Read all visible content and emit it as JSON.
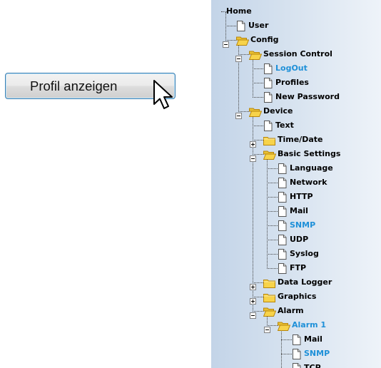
{
  "button": {
    "label": "Profil anzeigen"
  },
  "tree": {
    "items": [
      {
        "label": "Home",
        "level": 0,
        "type": "none",
        "toggle": "none",
        "highlight": false
      },
      {
        "label": "User",
        "level": 1,
        "type": "file",
        "toggle": "none",
        "highlight": false
      },
      {
        "label": "Config",
        "level": 1,
        "type": "folder-open",
        "toggle": "minus",
        "highlight": false
      },
      {
        "label": "Session Control",
        "level": 2,
        "type": "folder-open",
        "toggle": "minus",
        "highlight": false
      },
      {
        "label": "LogOut",
        "level": 3,
        "type": "file",
        "toggle": "none",
        "highlight": true
      },
      {
        "label": "Profiles",
        "level": 3,
        "type": "file",
        "toggle": "none",
        "highlight": false
      },
      {
        "label": "New Password",
        "level": 3,
        "type": "file",
        "toggle": "none",
        "highlight": false
      },
      {
        "label": "Device",
        "level": 2,
        "type": "folder-open",
        "toggle": "minus",
        "highlight": false
      },
      {
        "label": "Text",
        "level": 3,
        "type": "file",
        "toggle": "none",
        "highlight": false
      },
      {
        "label": "Time/Date",
        "level": 3,
        "type": "folder",
        "toggle": "plus",
        "highlight": false
      },
      {
        "label": "Basic Settings",
        "level": 3,
        "type": "folder-open",
        "toggle": "minus",
        "highlight": false
      },
      {
        "label": "Language",
        "level": 4,
        "type": "file",
        "toggle": "none",
        "highlight": false
      },
      {
        "label": "Network",
        "level": 4,
        "type": "file",
        "toggle": "none",
        "highlight": false
      },
      {
        "label": "HTTP",
        "level": 4,
        "type": "file",
        "toggle": "none",
        "highlight": false
      },
      {
        "label": "Mail",
        "level": 4,
        "type": "file",
        "toggle": "none",
        "highlight": false
      },
      {
        "label": "SNMP",
        "level": 4,
        "type": "file",
        "toggle": "none",
        "highlight": true
      },
      {
        "label": "UDP",
        "level": 4,
        "type": "file",
        "toggle": "none",
        "highlight": false
      },
      {
        "label": "Syslog",
        "level": 4,
        "type": "file",
        "toggle": "none",
        "highlight": false
      },
      {
        "label": "FTP",
        "level": 4,
        "type": "file",
        "toggle": "none",
        "highlight": false
      },
      {
        "label": "Data Logger",
        "level": 3,
        "type": "folder",
        "toggle": "plus",
        "highlight": false
      },
      {
        "label": "Graphics",
        "level": 3,
        "type": "folder",
        "toggle": "plus",
        "highlight": false
      },
      {
        "label": "Alarm",
        "level": 3,
        "type": "folder-open",
        "toggle": "minus",
        "highlight": false
      },
      {
        "label": "Alarm 1",
        "level": 4,
        "type": "folder-open",
        "toggle": "minus",
        "highlight": true
      },
      {
        "label": "Mail",
        "level": 5,
        "type": "file",
        "toggle": "none",
        "highlight": false
      },
      {
        "label": "SNMP",
        "level": 5,
        "type": "file",
        "toggle": "none",
        "highlight": true
      },
      {
        "label": "TCP",
        "level": 5,
        "type": "file",
        "toggle": "none",
        "highlight": false
      }
    ]
  },
  "colors": {
    "link_blue": "#1e90d8",
    "folder_yellow": "#f7d34a",
    "button_border": "#3c7fb1"
  },
  "icons": [
    "mouse-pointer-icon",
    "file-icon",
    "folder-icon",
    "folder-open-icon",
    "tree-expand-icon",
    "tree-collapse-icon"
  ]
}
